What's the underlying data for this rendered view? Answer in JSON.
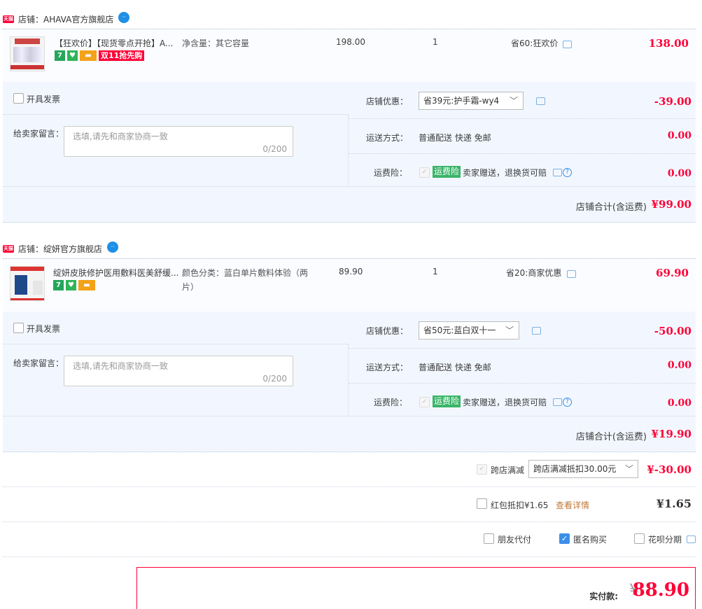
{
  "shops": [
    {
      "name": "店铺：AHAVA官方旗舰店",
      "tmall": "天猫",
      "item": {
        "title": "【狂欢价】【现货零点开抢】A...",
        "spec": "净含量：其它容量",
        "spec_line2": "",
        "unit_price": "198.00",
        "qty": "1",
        "discount": "省60:狂欢价",
        "subtotal": "138.00",
        "sale_badge": "双11抢先购",
        "seven": "7"
      },
      "invoice": "开具发票",
      "msg_label": "给卖家留言：",
      "msg_placeholder": "选填,请先和商家协商一致",
      "msg_count": "0/200",
      "coupon_label": "店铺优惠：",
      "coupon_value": "省39元:护手霜-wy4",
      "coupon_amount": "-39.00",
      "ship_label": "运送方式：",
      "ship_value": "普通配送 快递 免邮",
      "ship_amount": "0.00",
      "ins_label": "运费险：",
      "ins_tag": "运费险",
      "ins_text": "卖家赠送，退换货可赔",
      "ins_amount": "0.00",
      "total_label": "店铺合计(含运费)",
      "total_value": "¥99.00"
    },
    {
      "name": "店铺：绽妍官方旗舰店",
      "tmall": "天猫",
      "item": {
        "title": "绽妍皮肤修护医用敷料医美舒缓...",
        "spec": "颜色分类：蓝白单片敷料体验（两",
        "spec_line2": "片）",
        "unit_price": "89.90",
        "qty": "1",
        "discount": "省20:商家优惠",
        "subtotal": "69.90",
        "sale_badge": "",
        "seven": "7"
      },
      "invoice": "开具发票",
      "msg_label": "给卖家留言：",
      "msg_placeholder": "选填,请先和商家协商一致",
      "msg_count": "0/200",
      "coupon_label": "店铺优惠：",
      "coupon_value": "省50元:蓝白双十一",
      "coupon_amount": "-50.00",
      "ship_label": "运送方式：",
      "ship_value": "普通配送 快递 免邮",
      "ship_amount": "0.00",
      "ins_label": "运费险：",
      "ins_tag": "运费险",
      "ins_text": "卖家赠送，退换货可赔",
      "ins_amount": "0.00",
      "total_label": "店铺合计(含运费)",
      "total_value": "¥19.90"
    }
  ],
  "cross": {
    "label": "跨店满减",
    "select": "跨店满减抵扣30.00元",
    "amount": "¥-30.00"
  },
  "redpacket": {
    "label": "红包抵扣¥1.65",
    "link": "查看详情",
    "amount": "¥1.65"
  },
  "options": {
    "friend_pay": "朋友代付",
    "anonymous": "匿名购买",
    "huabei": "花呗分期"
  },
  "payment": {
    "label": "实付款:",
    "currency": "¥",
    "amount": "88.90"
  },
  "colors": {
    "accent_red": "#ff0036",
    "panel_blue": "#f2f7ff",
    "link_orange": "#c07a3a"
  }
}
